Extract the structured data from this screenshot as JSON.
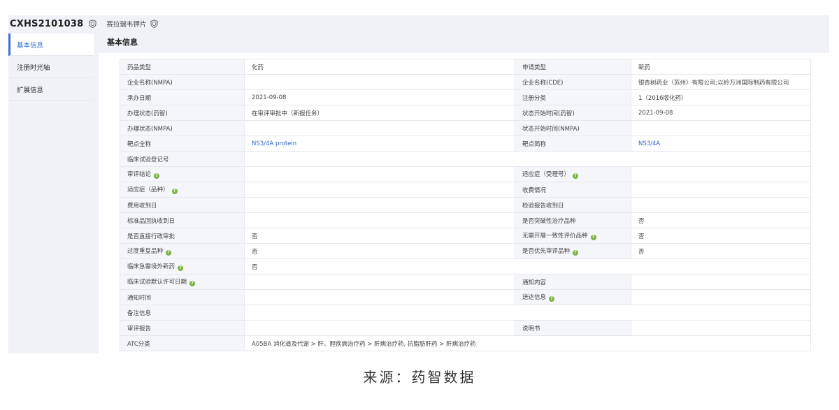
{
  "header": {
    "code": "CXHS2101038",
    "drug_name": "赛拉瑞韦钾片"
  },
  "sidebar": {
    "items": [
      {
        "label": "基本信息",
        "active": true
      },
      {
        "label": "注册时光轴",
        "active": false
      },
      {
        "label": "扩展信息",
        "active": false
      }
    ]
  },
  "main": {
    "section_title": "基本信息"
  },
  "table": {
    "rows": [
      {
        "l1": "药品类型",
        "v1": "化药",
        "l2": "申请类型",
        "v2": "新药"
      },
      {
        "l1": "企业名称(NMPA)",
        "v1": "",
        "l2": "企业名称(CDE)",
        "v2": "银杏树药业（苏州）有限公司;以岭万洲国际制药有限公司"
      },
      {
        "l1": "承办日期",
        "v1": "2021-09-08",
        "l2": "注册分类",
        "v2": "1（2016版化药）"
      },
      {
        "l1": "办理状态(药智)",
        "v1": "在审评审批中（新报任务）",
        "l2": "状态开始时间(药智)",
        "v2": "2021-09-08"
      },
      {
        "l1": "办理状态(NMPA)",
        "v1": "",
        "l2": "状态开始时间(NMPA)",
        "v2": ""
      },
      {
        "l1": "靶点全称",
        "v1": "NS3/4A protein",
        "l2": "靶点简称",
        "v2": "NS3/4A"
      },
      {
        "l1": "临床试验登记号",
        "v1": ""
      },
      {
        "l1": "审评结论",
        "v1": "",
        "l2": "适应症（受理号）",
        "v2": ""
      },
      {
        "l1": "适应症（品种）",
        "v1": "",
        "l2": "收费情况",
        "v2": ""
      },
      {
        "l1": "费用收到日",
        "v1": "",
        "l2": "检验报告收到日",
        "v2": ""
      },
      {
        "l1": "标准品回执收到日",
        "v1": "",
        "l2": "是否突破性治疗品种",
        "v2": "否"
      },
      {
        "l1": "是否直接行政审批",
        "v1": "否",
        "l2": "无需开展一致性评价品种",
        "v2": "否"
      },
      {
        "l1": "过度重复品种",
        "v1": "否",
        "l2": "是否优先审评品种",
        "v2": "否"
      },
      {
        "l1": "临床急需境外新药",
        "v1": "否"
      },
      {
        "l1": "临床试验默认许可日期",
        "v1": "",
        "l2": "通知内容",
        "v2": ""
      },
      {
        "l1": "通知时间",
        "v1": "",
        "l2": "送达信息",
        "v2": ""
      },
      {
        "l1": "备注信息",
        "v1": ""
      },
      {
        "l1": "审评报告",
        "v1": "",
        "l2": "说明书",
        "v2": ""
      },
      {
        "l1": "ATC分类",
        "v1": "A05BA  消化道及代谢 > 肝、胆疾病治疗药 > 肝病治疗药, 抗脂肪肝药 > 肝病治疗药"
      }
    ]
  },
  "help_icon": "question-circle-icon",
  "accent_color": "#3a6fd8",
  "caption": "来源：药智数据"
}
